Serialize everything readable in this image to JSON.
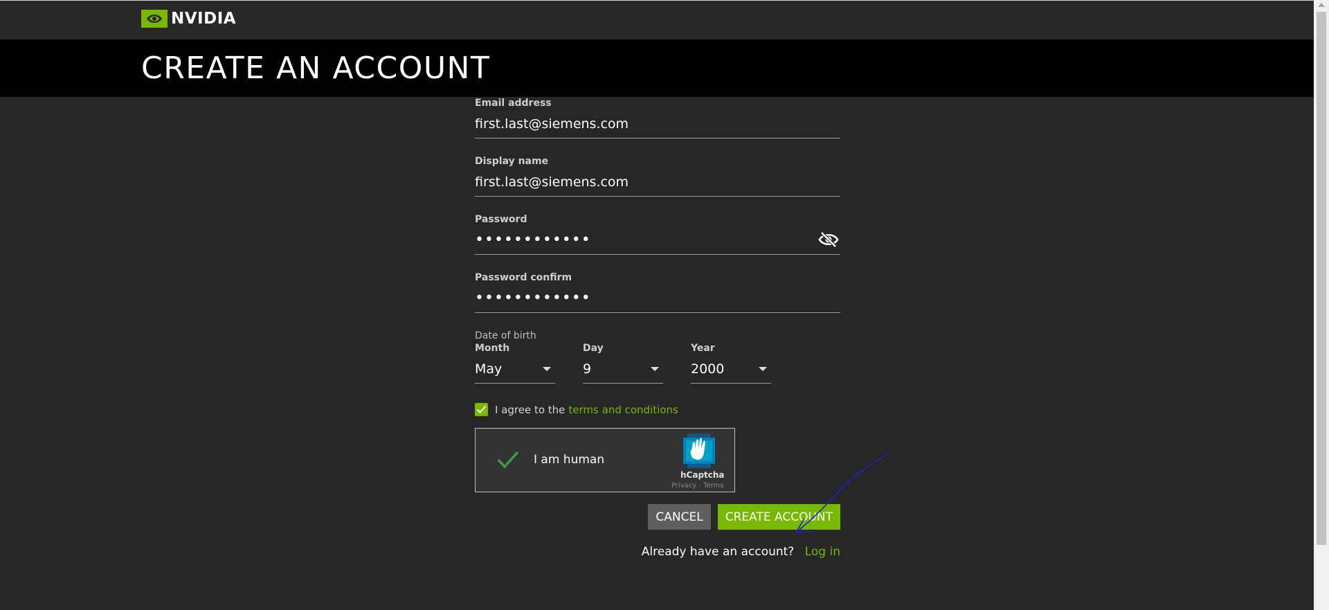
{
  "header": {
    "logo_text": "NVIDIA",
    "brand_color": "#76b900",
    "page_title": "CREATE AN ACCOUNT"
  },
  "form": {
    "email": {
      "label": "Email address",
      "value": "first.last@siemens.com"
    },
    "display_name": {
      "label": "Display name",
      "value": "first.last@siemens.com"
    },
    "password": {
      "label": "Password",
      "value": "••••••••••••"
    },
    "password_confirm": {
      "label": "Password confirm",
      "value": "••••••••••••"
    },
    "dob": {
      "label": "Date of birth",
      "month": {
        "label": "Month",
        "value": "May"
      },
      "day": {
        "label": "Day",
        "value": "9"
      },
      "year": {
        "label": "Year",
        "value": "2000"
      }
    },
    "agree": {
      "checked": true,
      "text": "I agree to the",
      "link": "terms and conditions"
    },
    "captcha": {
      "text": "I am human",
      "brand": "hCaptcha",
      "links": "Privacy - Terms"
    },
    "buttons": {
      "cancel": "CANCEL",
      "create": "CREATE ACCOUNT"
    },
    "login": {
      "prompt": "Already have an account?",
      "link": "Log in"
    }
  },
  "colors": {
    "background": "#272727",
    "title_band": "#000000",
    "accent": "#76b900",
    "cancel_button": "#5e5e5e"
  }
}
